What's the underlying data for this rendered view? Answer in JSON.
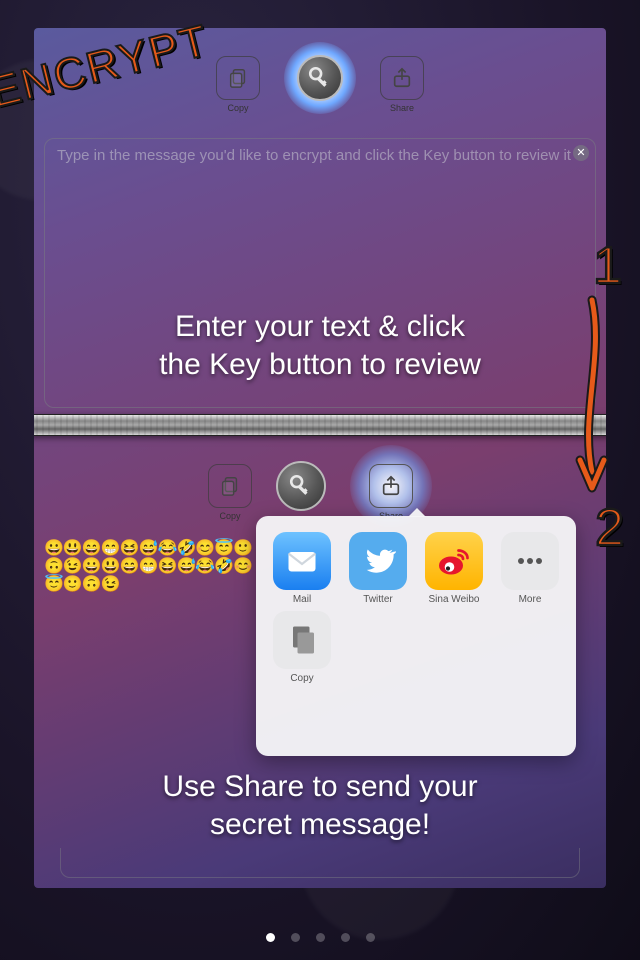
{
  "stamp": "ENCRYPT",
  "toolbar_top": {
    "copy_label": "Copy",
    "share_label": "Share"
  },
  "message1": {
    "placeholder": "Type in the message you'd like to encrypt and click the Key button to review it"
  },
  "caption1_line1": "Enter your text & click",
  "caption1_line2": "the Key button to review",
  "toolbar_bottom": {
    "copy_label": "Copy",
    "share_label": "Share"
  },
  "emoji_text": "😀😃😄😁😆😅😂🤣😊😇🙂🙃😉😀😃😄😁😆😅😂🤣😊😇🙂🙃😉",
  "share_sheet": {
    "items": [
      {
        "label": "Mail"
      },
      {
        "label": "Twitter"
      },
      {
        "label": "Sina Weibo"
      },
      {
        "label": "More"
      }
    ],
    "row2": [
      {
        "label": "Copy"
      }
    ]
  },
  "caption2_line1": "Use Share to send your",
  "caption2_line2": "secret message!",
  "steps": {
    "one": "1",
    "two": "2"
  },
  "pager": {
    "count": 5,
    "active": 0
  }
}
